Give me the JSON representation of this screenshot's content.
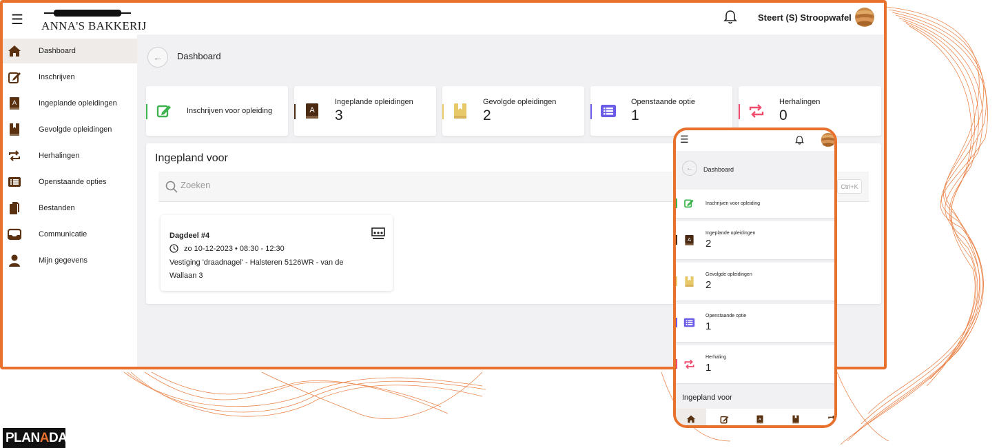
{
  "app": {
    "logo_text": "ANNA'S BAKKERIJ",
    "user_name": "Steert (S) Stroopwafel"
  },
  "sidebar": {
    "items": [
      {
        "label": "Dashboard",
        "icon": "home-icon"
      },
      {
        "label": "Inschrijven",
        "icon": "edit-icon"
      },
      {
        "label": "Ingeplande opleidingen",
        "icon": "book-a-icon"
      },
      {
        "label": "Gevolgde opleidingen",
        "icon": "bookmark-book-icon"
      },
      {
        "label": "Herhalingen",
        "icon": "repeat-icon"
      },
      {
        "label": "Openstaande opties",
        "icon": "list-icon"
      },
      {
        "label": "Bestanden",
        "icon": "files-icon"
      },
      {
        "label": "Communicatie",
        "icon": "inbox-icon"
      },
      {
        "label": "Mijn gegevens",
        "icon": "user-icon"
      }
    ]
  },
  "breadcrumb": {
    "current": "Dashboard"
  },
  "stats": [
    {
      "label": "Inschrijven voor opleiding",
      "value": "",
      "color": "#3fb34f",
      "icon": "edit-icon"
    },
    {
      "label": "Ingeplande opleidingen",
      "value": "3",
      "color": "#4a2a12",
      "icon": "book-a-icon"
    },
    {
      "label": "Gevolgde opleidingen",
      "value": "2",
      "color": "#e8c96a",
      "icon": "bookmark-book-icon"
    },
    {
      "label": "Openstaande optie",
      "value": "1",
      "color": "#6b5ce7",
      "icon": "list-icon"
    },
    {
      "label": "Herhalingen",
      "value": "0",
      "color": "#ef4c6e",
      "icon": "repeat-icon"
    }
  ],
  "panel": {
    "title": "Ingepland voor",
    "search_placeholder": "Zoeken",
    "shortcut": "Ctrl+K",
    "session": {
      "title": "Dagdeel #4",
      "datetime": "zo 10-12-2023 • 08:30 - 12:30",
      "location": "Vestiging 'draadnagel' - Halsteren 5126WR - van de Wallaan 3",
      "icon": "classroom-icon"
    }
  },
  "mobile": {
    "breadcrumb": "Dashboard",
    "cards": [
      {
        "label": "Inschrijven voor opleiding",
        "value": ""
      },
      {
        "label": "Ingeplande opleidingen",
        "value": "2"
      },
      {
        "label": "Gevolgde opleidingen",
        "value": "2"
      },
      {
        "label": "Openstaande optie",
        "value": "1"
      },
      {
        "label": "Herhaling",
        "value": "1"
      }
    ],
    "section_title": "Ingepland voor"
  },
  "footer_logo": {
    "part1": "PLAN",
    "part2": "A",
    "part3": "DAY"
  },
  "colors": {
    "accent": "#e8712d",
    "brand_brown": "#5a3212"
  }
}
